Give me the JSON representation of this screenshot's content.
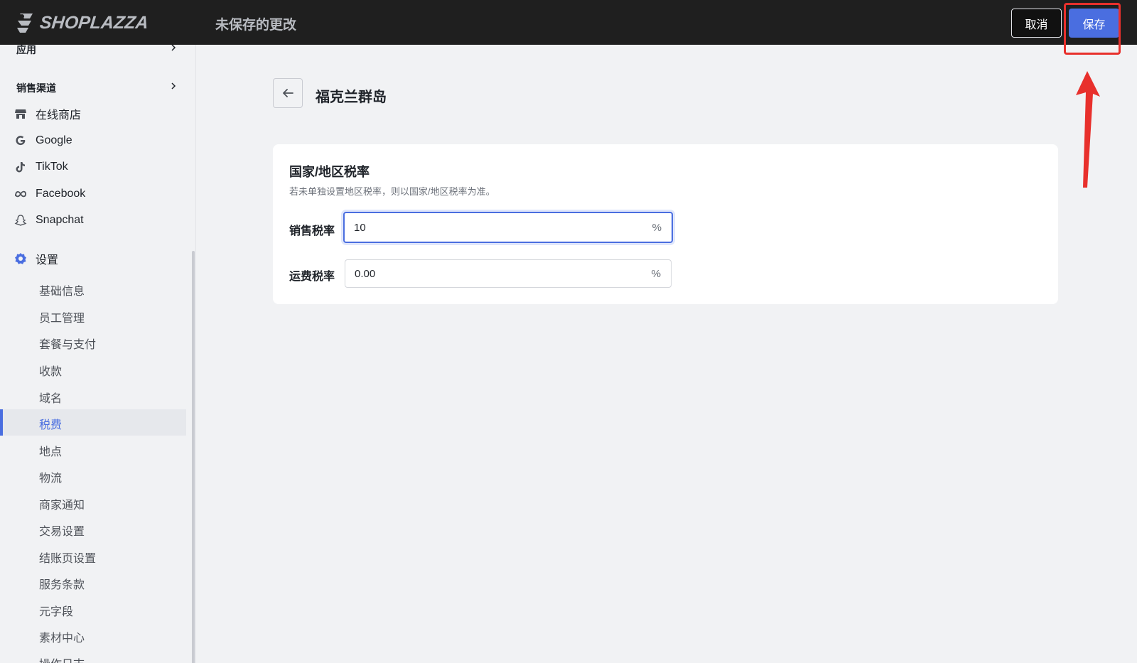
{
  "header": {
    "logo_text": "SHOPLAZZA",
    "unsaved_text": "未保存的更改",
    "cancel_label": "取消",
    "save_label": "保存"
  },
  "sidebar": {
    "apps_section": "应用",
    "channels_section": "销售渠道",
    "channels": [
      {
        "label": "在线商店",
        "icon": "store-icon"
      },
      {
        "label": "Google",
        "icon": "google-icon"
      },
      {
        "label": "TikTok",
        "icon": "tiktok-icon"
      },
      {
        "label": "Facebook",
        "icon": "meta-icon"
      },
      {
        "label": "Snapchat",
        "icon": "snapchat-icon"
      }
    ],
    "settings_label": "设置",
    "settings_items": [
      {
        "label": "基础信息"
      },
      {
        "label": "员工管理"
      },
      {
        "label": "套餐与支付"
      },
      {
        "label": "收款"
      },
      {
        "label": "域名"
      },
      {
        "label": "税费",
        "active": true
      },
      {
        "label": "地点"
      },
      {
        "label": "物流"
      },
      {
        "label": "商家通知"
      },
      {
        "label": "交易设置"
      },
      {
        "label": "结账页设置"
      },
      {
        "label": "服务条款"
      },
      {
        "label": "元字段"
      },
      {
        "label": "素材中心"
      },
      {
        "label": "操作日志"
      }
    ]
  },
  "main": {
    "page_title": "福克兰群岛",
    "card": {
      "title": "国家/地区税率",
      "description": "若未单独设置地区税率，则以国家/地区税率为准。",
      "sales_tax": {
        "label": "销售税率",
        "value": "10",
        "suffix": "%"
      },
      "shipping_tax": {
        "label": "运费税率",
        "value": "0.00",
        "suffix": "%"
      }
    }
  },
  "colors": {
    "accent": "#4a6ee0",
    "annotation": "#e8302c",
    "topbar": "#1f1f1f"
  }
}
